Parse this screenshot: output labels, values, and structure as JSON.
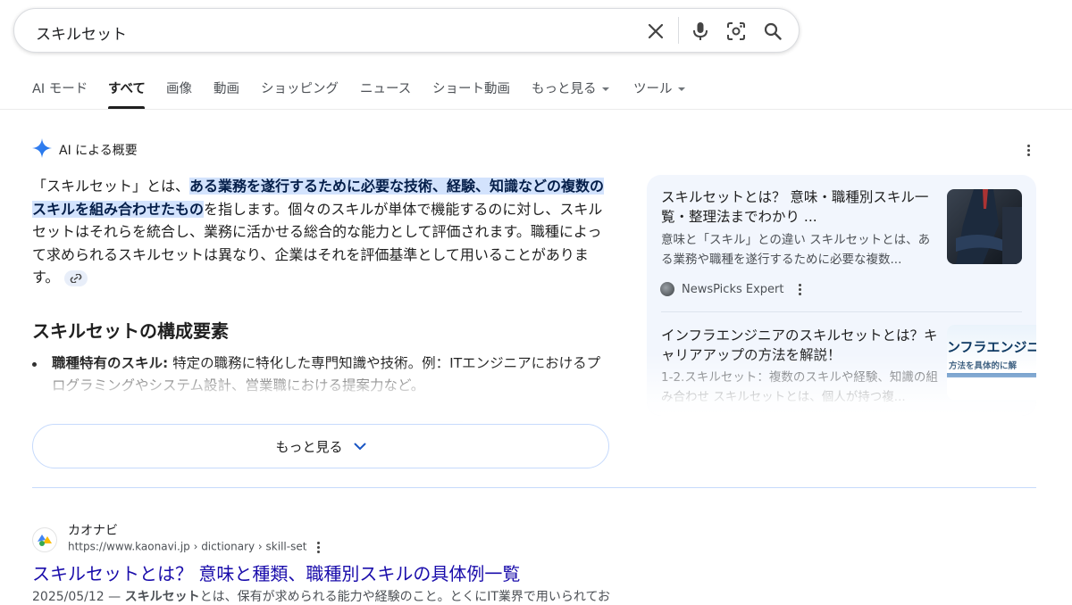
{
  "search": {
    "query": "スキルセット"
  },
  "tabs": [
    {
      "label": "AI モード"
    },
    {
      "label": "すべて"
    },
    {
      "label": "画像"
    },
    {
      "label": "動画"
    },
    {
      "label": "ショッピング"
    },
    {
      "label": "ニュース"
    },
    {
      "label": "ショート動画"
    },
    {
      "label": "もっと見る"
    },
    {
      "label": "ツール"
    }
  ],
  "ai_overview": {
    "header": "AI による概要",
    "intro_before": "「スキルセット」とは、",
    "intro_highlight": "ある業務を遂行するために必要な技術、経験、知識などの複数のスキルを組み合わせたもの",
    "intro_after": "を指します。個々のスキルが単体で機能するのに対し、スキルセットはそれらを統合し、業務に活かせる総合的な能力として評価されます。職種によって求められるスキルセットは異なり、企業はそれを評価基準として用いることがあります。",
    "section_heading": "スキルセットの構成要素",
    "bullet_label": "職種特有のスキル:",
    "bullet_text": " 特定の職務に特化した専門知識や技術。例：ITエンジニアにおけるプログラミングやシステム設計、営業職における提案力など。",
    "more_button": "もっと見る"
  },
  "side_cards": [
    {
      "title": "スキルセットとは？ 意味・職種別スキル一覧・整理法までわかり ...",
      "snippet": "意味と「スキル」との違い スキルセットとは、ある業務や職種を遂行するために必要な複数...",
      "source": "NewsPicks Expert"
    },
    {
      "title": "インフラエンジニアのスキルセットとは？キャリアアップの方法を解説！",
      "snippet": "1-2.スキルセット：複数のスキルや経験、知識の組み合わせ スキルセットとは、個人が持つ複...",
      "thumb_text_1": "ンフラエンジニ",
      "thumb_text_2": "方法を具体的に解"
    }
  ],
  "result": {
    "site_name": "カオナビ",
    "url": "https://www.kaonavi.jp › dictionary › skill-set",
    "title": "スキルセットとは？ 意味と種類、職種別スキルの具体例一覧",
    "date": "2025/05/12",
    "dash": " — ",
    "snippet_bold": "スキルセット",
    "snippet_rest": "とは、保有が求められる能力や経験のこと。とくにIT業界で用いられてお"
  }
}
